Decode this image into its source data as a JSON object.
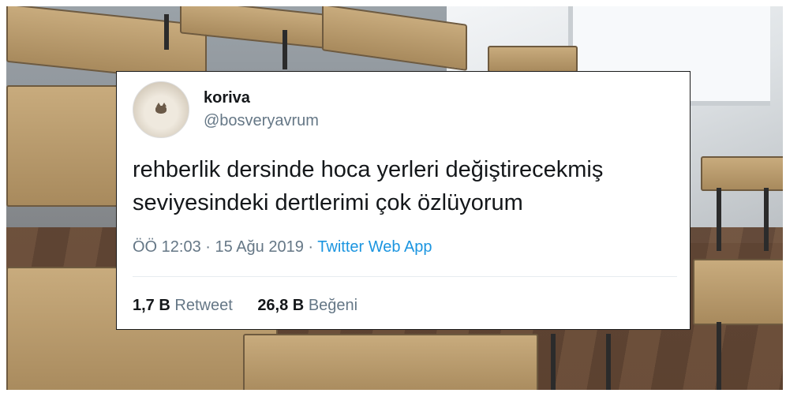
{
  "tweet": {
    "display_name": "koriva",
    "handle": "@bosveryavrum",
    "text_line1": "rehberlik dersinde hoca yerleri değiştirecekmiş",
    "text_line2": "seviyesindeki dertlerimi çok özlüyorum",
    "time": "ÖÖ 12:03",
    "separator": "·",
    "date": "15 Ağu 2019",
    "source": "Twitter Web App",
    "retweet_count": "1,7 B",
    "retweet_label": "Retweet",
    "like_count": "26,8 B",
    "like_label": "Beğeni"
  },
  "colors": {
    "link": "#1b95e0",
    "secondary_text": "#657786",
    "primary_text": "#14171a"
  },
  "icons": [
    "avatar-image"
  ]
}
